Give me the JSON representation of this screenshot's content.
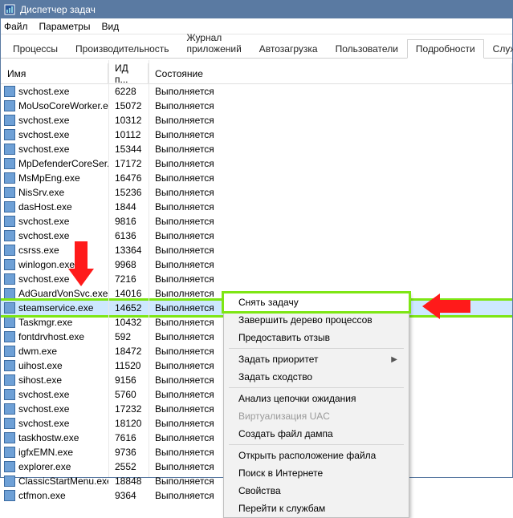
{
  "window": {
    "title": "Диспетчер задач"
  },
  "menu": {
    "file": "Файл",
    "options": "Параметры",
    "view": "Вид"
  },
  "tabs": [
    "Процессы",
    "Производительность",
    "Журнал приложений",
    "Автозагрузка",
    "Пользователи",
    "Подробности",
    "Службы"
  ],
  "active_tab": 5,
  "columns": {
    "name": "Имя",
    "pid": "ИД п...",
    "state": "Состояние"
  },
  "status_label": "Выполняется",
  "processes": [
    {
      "name": "svchost.exe",
      "pid": "6228"
    },
    {
      "name": "MoUsoCoreWorker.exe",
      "pid": "15072"
    },
    {
      "name": "svchost.exe",
      "pid": "10312"
    },
    {
      "name": "svchost.exe",
      "pid": "10112"
    },
    {
      "name": "svchost.exe",
      "pid": "15344"
    },
    {
      "name": "MpDefenderCoreSer...",
      "pid": "17172"
    },
    {
      "name": "MsMpEng.exe",
      "pid": "16476"
    },
    {
      "name": "NisSrv.exe",
      "pid": "15236"
    },
    {
      "name": "dasHost.exe",
      "pid": "1844"
    },
    {
      "name": "svchost.exe",
      "pid": "9816"
    },
    {
      "name": "svchost.exe",
      "pid": "6136"
    },
    {
      "name": "csrss.exe",
      "pid": "13364"
    },
    {
      "name": "winlogon.exe",
      "pid": "9968"
    },
    {
      "name": "svchost.exe",
      "pid": "7216"
    },
    {
      "name": "AdGuardVonSvc.exe",
      "pid": "14016"
    },
    {
      "name": "steamservice.exe",
      "pid": "14652",
      "selected": true,
      "highlight": true
    },
    {
      "name": "Taskmgr.exe",
      "pid": "10432"
    },
    {
      "name": "fontdrvhost.exe",
      "pid": "592"
    },
    {
      "name": "dwm.exe",
      "pid": "18472"
    },
    {
      "name": "uihost.exe",
      "pid": "11520"
    },
    {
      "name": "sihost.exe",
      "pid": "9156"
    },
    {
      "name": "svchost.exe",
      "pid": "5760"
    },
    {
      "name": "svchost.exe",
      "pid": "17232"
    },
    {
      "name": "svchost.exe",
      "pid": "18120"
    },
    {
      "name": "taskhostw.exe",
      "pid": "7616"
    },
    {
      "name": "igfxEMN.exe",
      "pid": "9736"
    },
    {
      "name": "explorer.exe",
      "pid": "2552"
    },
    {
      "name": "ClassicStartMenu.exe",
      "pid": "18848"
    },
    {
      "name": "ctfmon.exe",
      "pid": "9364"
    }
  ],
  "context_menu": [
    {
      "label": "Снять задачу",
      "hl": true
    },
    {
      "label": "Завершить дерево процессов"
    },
    {
      "label": "Предоставить отзыв"
    },
    {
      "sep": true
    },
    {
      "label": "Задать приоритет",
      "sub": true
    },
    {
      "label": "Задать сходство"
    },
    {
      "sep": true
    },
    {
      "label": "Анализ цепочки ожидания"
    },
    {
      "label": "Виртуализация UAC",
      "disabled": true
    },
    {
      "label": "Создать файл дампа"
    },
    {
      "sep": true
    },
    {
      "label": "Открыть расположение файла"
    },
    {
      "label": "Поиск в Интернете"
    },
    {
      "label": "Свойства"
    },
    {
      "label": "Перейти к службам"
    }
  ]
}
